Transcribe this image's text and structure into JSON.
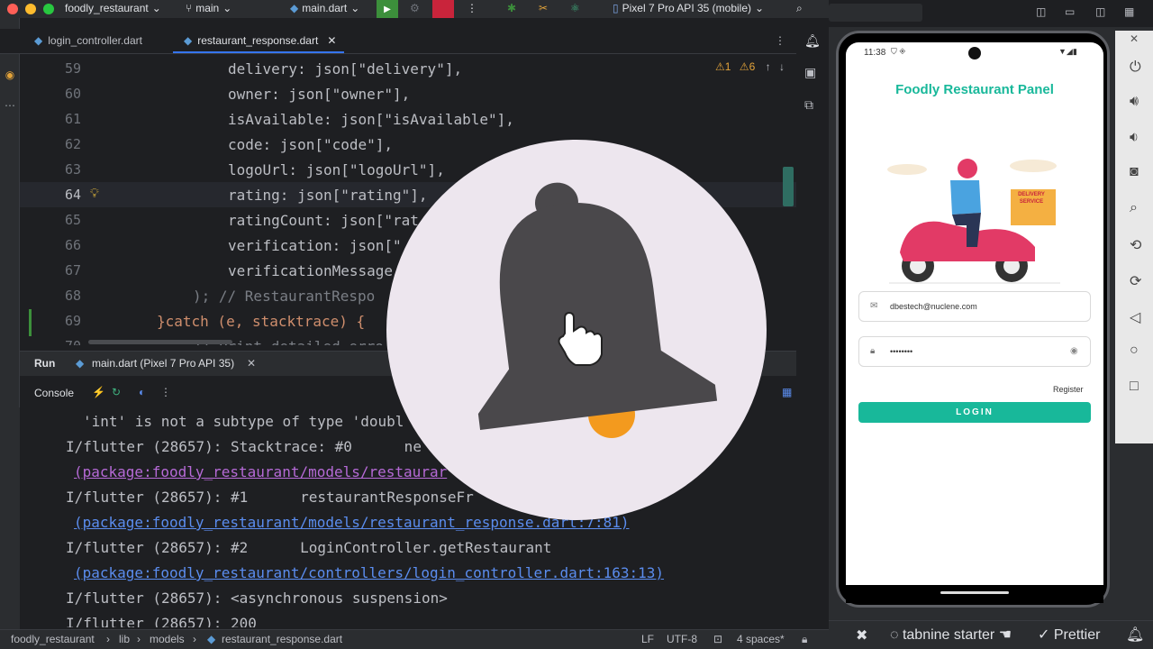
{
  "titlebar": {
    "project": "foodly_restaurant",
    "branch": "main",
    "run_config": "main.dart",
    "device": "Pixel 7 Pro API 35 (mobile)"
  },
  "tabs": [
    {
      "label": "login_controller.dart"
    },
    {
      "label": "restaurant_response.dart"
    }
  ],
  "editor": {
    "inspection": {
      "warnings": "1",
      "weak_warnings": "6"
    },
    "lines": [
      {
        "num": "59",
        "text": "delivery: json[\"delivery\"],"
      },
      {
        "num": "60",
        "text": "owner: json[\"owner\"],"
      },
      {
        "num": "61",
        "text": "isAvailable: json[\"isAvailable\"],"
      },
      {
        "num": "62",
        "text": "code: json[\"code\"],"
      },
      {
        "num": "63",
        "text": "logoUrl: json[\"logoUrl\"],"
      },
      {
        "num": "64",
        "text": "rating: json[\"rating\"],"
      },
      {
        "num": "65",
        "text": "ratingCount: json[\"rat"
      },
      {
        "num": "66",
        "text": "verification: json[\""
      },
      {
        "num": "67",
        "text": "verificationMessage"
      },
      {
        "num": "68",
        "text": "); // RestaurantRespo"
      },
      {
        "num": "69",
        "text": "}catch (e, stacktrace) {"
      },
      {
        "num": "70",
        "text": "// Print detailed erro"
      }
    ]
  },
  "run_panel": {
    "tab_run": "Run",
    "tab_config": "main.dart (Pixel 7 Pro API 35)",
    "console_label": "Console"
  },
  "console": {
    "lines": [
      "'int' is not a subtype of type 'doubl",
      "I/flutter (28657): Stacktrace: #0      ne",
      "(package:foodly_restaurant/models/restaurar",
      "I/flutter (28657): #1      restaurantResponseFr",
      "(package:foodly_restaurant/models/restaurant_response.dart:7:81)",
      "I/flutter (28657): #2      LoginController.getRestaurant",
      "(package:foodly_restaurant/controllers/login_controller.dart:163:13)",
      "I/flutter (28657): <asynchronous suspension>",
      "I/flutter (28657): 200"
    ]
  },
  "statusbar": {
    "crumbs": [
      "foodly_restaurant",
      "lib",
      "models",
      "restaurant_response.dart"
    ],
    "line_sep": "LF",
    "encoding": "UTF-8",
    "indent": "4 spaces*"
  },
  "plugins": {
    "tabnine": "tabnine starter",
    "prettier": "Prettier"
  },
  "phone": {
    "time": "11:38",
    "app_title": "Foodly Restaurant Panel",
    "illustration_text": "DELIVERY SERVICE",
    "email_value": "dbestech@nuclene.com",
    "password_value": "••••••••",
    "register_label": "Register",
    "login_label": "LOGIN"
  },
  "colors": {
    "accent": "#18b89a",
    "ide_bg": "#1e1f22",
    "string": "#6aab73",
    "keyword": "#cf8e6d",
    "bell": "#4a484b",
    "bell_clapper": "#f39a1e"
  }
}
